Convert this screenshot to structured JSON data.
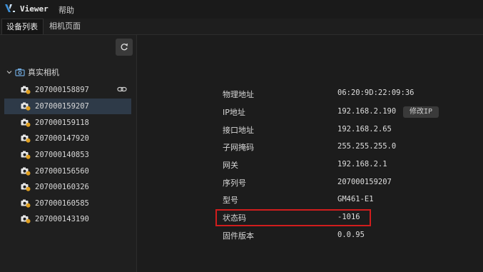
{
  "titlebar": {
    "app_name": "Viewer",
    "menu_help": "帮助"
  },
  "tabs": [
    {
      "label": "设备列表"
    },
    {
      "label": "相机页面"
    }
  ],
  "tree": {
    "root_label": "真实相机",
    "devices": [
      {
        "sn": "207000158897"
      },
      {
        "sn": "207000159207"
      },
      {
        "sn": "207000159118"
      },
      {
        "sn": "207000147920"
      },
      {
        "sn": "207000140853"
      },
      {
        "sn": "207000156560"
      },
      {
        "sn": "207000160326"
      },
      {
        "sn": "207000160585"
      },
      {
        "sn": "207000143190"
      }
    ]
  },
  "properties": [
    {
      "label": "物理地址",
      "value": "06:20:9D:22:09:36"
    },
    {
      "label": "IP地址",
      "value": "192.168.2.190"
    },
    {
      "label": "接口地址",
      "value": "192.168.2.65"
    },
    {
      "label": "子网掩码",
      "value": "255.255.255.0"
    },
    {
      "label": "网关",
      "value": "192.168.2.1"
    },
    {
      "label": "序列号",
      "value": "207000159207"
    },
    {
      "label": "型号",
      "value": "GM461-E1"
    },
    {
      "label": "状态码",
      "value": "-1016"
    },
    {
      "label": "固件版本",
      "value": "0.0.95"
    }
  ],
  "modify_ip_button": "修改IP",
  "colors": {
    "accent_logo": "#3d8fd6",
    "selected_row": "#2e3a48",
    "highlight_border": "#d11d1d",
    "camera_badge": "#e0a020"
  }
}
